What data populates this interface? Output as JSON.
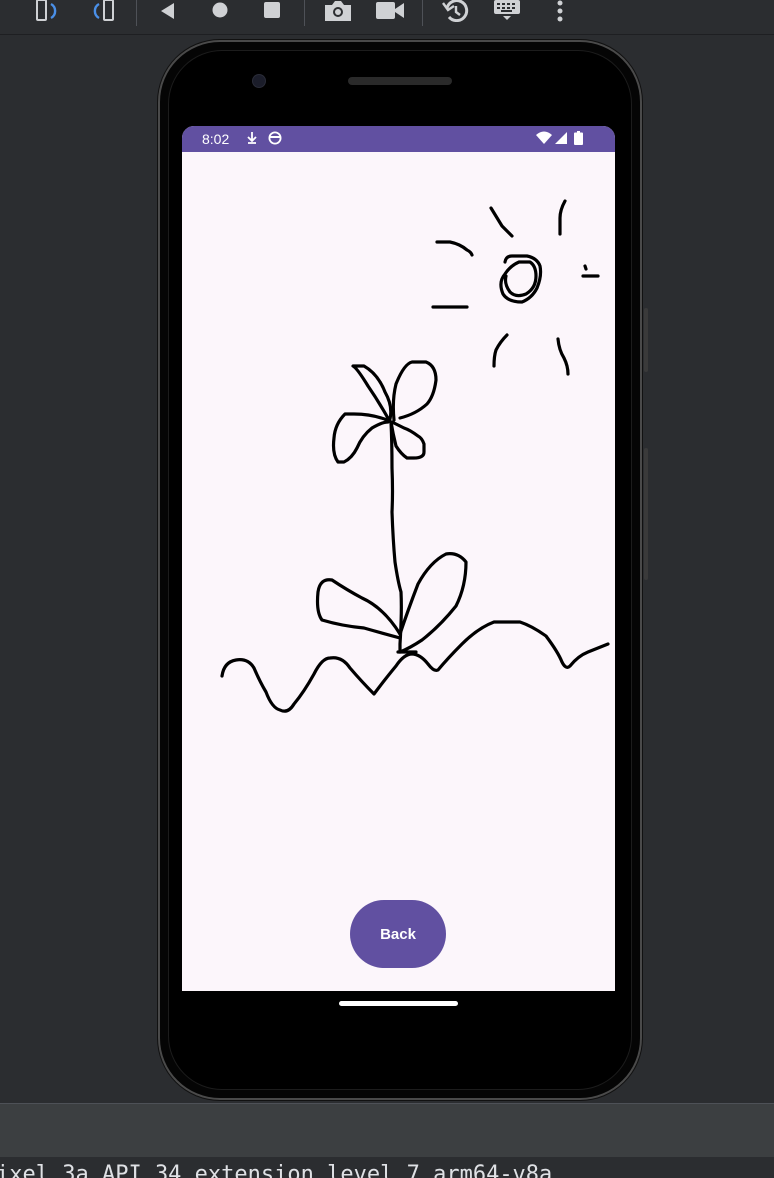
{
  "toolbar": {
    "icons": [
      "rotate-left-icon",
      "rotate-right-icon",
      "back-triangle-icon",
      "home-circle-icon",
      "overview-square-icon",
      "camera-icon",
      "video-icon",
      "snapshot-history-icon",
      "keyboard-icon",
      "more-vert-icon"
    ]
  },
  "status_bar": {
    "time": "8:02",
    "background": "#6150a1",
    "icons": [
      "download-icon",
      "face-icon",
      "wifi-icon",
      "signal-icon",
      "battery-icon"
    ]
  },
  "app": {
    "back_label": "Back",
    "accent": "#6150a1",
    "canvas_background": "#fcf6fb",
    "drawing_subject": [
      "sun",
      "flower",
      "ground"
    ]
  },
  "footer": {
    "device_label": "ixel 3a API 34 extension level 7 arm64-v8a"
  }
}
